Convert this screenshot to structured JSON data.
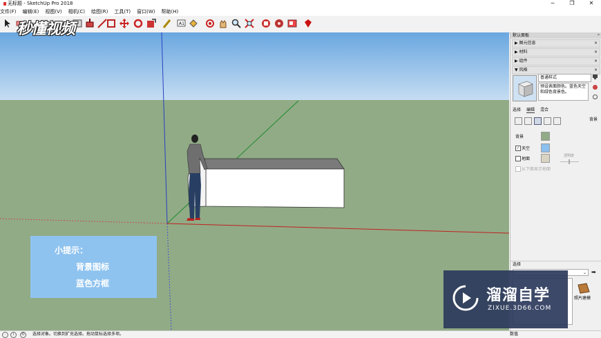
{
  "window": {
    "title": "无标题 - SketchUp Pro 2018",
    "controls": [
      "−",
      "❐",
      "✕"
    ]
  },
  "menubar": [
    "文件(F)",
    "编辑(E)",
    "视图(V)",
    "相机(C)",
    "绘图(R)",
    "工具(T)",
    "窗口(W)",
    "帮助(H)"
  ],
  "toolbar": {
    "tools": [
      "select-tool",
      "eraser-tool",
      "line-tool",
      "rectangle-tool",
      "push-pull-tool",
      "move-tool",
      "rotate-tool",
      "scale-tool",
      "offset-tool",
      "tape-measure-tool",
      "text-tool",
      "paint-bucket-tool",
      "orbit-tool",
      "pan-tool",
      "zoom-tool",
      "zoom-window-tool",
      "zoom-extents-tool",
      "warehouse-tool",
      "extension-tool",
      "send-to-layout-tool",
      "ruby-tool"
    ]
  },
  "logo_watermark": "秒懂视频",
  "viewport": {
    "tip": {
      "title": "小提示：",
      "line1": "背景图标",
      "line2": "蓝色方框"
    },
    "colors": {
      "sky": "#8fbde9",
      "ground": "#91ab86",
      "box_top": "#7a7a7a",
      "box_front": "#ffffff"
    }
  },
  "panel": {
    "tray_title": "默认面板",
    "sections": [
      {
        "label": "▶ 图元信息",
        "close": "×"
      },
      {
        "label": "▶ 材料",
        "close": "×"
      },
      {
        "label": "▶ 组件",
        "close": "×"
      },
      {
        "label": "▼ 风格",
        "close": "×"
      }
    ],
    "style_name": "普通样式",
    "style_desc": "预设表面颜色。蓝色天空和绿色背景色。",
    "tabs": [
      "选择",
      "编辑",
      "混合"
    ],
    "active_tab": "编辑",
    "background_label": "背景",
    "rows": {
      "background": {
        "label": "背景",
        "color": "#91ab86"
      },
      "sky": {
        "label": "天空",
        "checked": true,
        "color": "#8cc0ee"
      },
      "ground": {
        "label": "地面",
        "checked": false,
        "color": "#d9d3c3"
      },
      "show_ground_from_below": {
        "label": "从下面显示地面",
        "checked": false
      }
    },
    "opacity_label": "透明度",
    "select_section": {
      "title": "选择",
      "item_label": "照片建模"
    }
  },
  "brand_watermark": {
    "name": "溜溜自学",
    "url": "ZIXUE.3D66.COM"
  },
  "statusbar": {
    "message": "选择对象。切换到扩充选择。拖动鼠标选择多项。",
    "measure_label": "数值"
  }
}
